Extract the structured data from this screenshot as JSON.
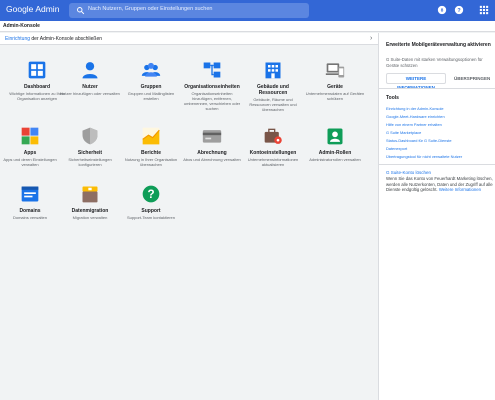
{
  "header": {
    "brand_google": "Google",
    "brand_product": "Admin",
    "search_placeholder": "Nach Nutzern, Gruppen oder Einstellungen suchen",
    "colors": {
      "bar": "#3367d6",
      "search": "#5b86e0"
    },
    "icons": [
      "search-icon",
      "support-icon",
      "help-icon",
      "apps-grid-icon"
    ]
  },
  "breadcrumb": {
    "label": "Admin-Konsole"
  },
  "setup_banner": {
    "link": "Einrichtung",
    "text": " der Admin-Konsole abschließen"
  },
  "tiles": [
    {
      "id": "dashboard",
      "title": "Dashboard",
      "desc": "Wichtige Informationen zu Ihrer Organisation anzeigen"
    },
    {
      "id": "users",
      "title": "Nutzer",
      "desc": "Nutzer hinzufügen oder verwalten"
    },
    {
      "id": "groups",
      "title": "Gruppen",
      "desc": "Gruppen und Mailinglisten erstellen"
    },
    {
      "id": "orgunits",
      "title": "Organisationseinheiten",
      "desc": "Organisationseinheiten hinzufügen, entfernen, umbenennen, verschieben oder suchen"
    },
    {
      "id": "buildings",
      "title": "Gebäude und Ressourcen",
      "desc": "Gebäude, Räume und Ressourcen verwalten und überwachen"
    },
    {
      "id": "devices",
      "title": "Geräte",
      "desc": "Unternehmensdaten auf Geräten schützen"
    },
    {
      "id": "apps",
      "title": "Apps",
      "desc": "Apps und deren Einstellungen verwalten"
    },
    {
      "id": "security",
      "title": "Sicherheit",
      "desc": "Sicherheitseinstellungen konfigurieren"
    },
    {
      "id": "reports",
      "title": "Berichte",
      "desc": "Nutzung in Ihrer Organisation überwachen"
    },
    {
      "id": "billing",
      "title": "Abrechnung",
      "desc": "Abos und Abrechnung verwalten"
    },
    {
      "id": "account",
      "title": "Kontoeinstellungen",
      "desc": "Unternehmensinformationen aktualisieren"
    },
    {
      "id": "roles",
      "title": "Admin-Rollen",
      "desc": "Administratorrollen verwalten"
    },
    {
      "id": "domains",
      "title": "Domains",
      "desc": "Domains verwalten"
    },
    {
      "id": "migration",
      "title": "Datenmigration",
      "desc": "Migration verwalten"
    },
    {
      "id": "support",
      "title": "Support",
      "desc": "Support-Team kontaktieren"
    }
  ],
  "panel": {
    "title": "Erweiterte Mobilgeräteverwaltung aktivieren",
    "desc": "G Suite-Daten mit starken Verwaltungsoptionen für Geräte schützen",
    "btn_more": "WEITERE INFORMATIONEN",
    "btn_skip": "ÜBERSPRINGEN",
    "tools_title": "Tools",
    "tools": [
      "Einrichtung in der Admin-Konsole",
      "Google-Meet-Hardware einrichten",
      "Hilfe von einem Partner erhalten",
      "G Suite Marketplace",
      "Status-Dashboard für G Suite-Dienste",
      "Datenexport",
      "Übertragungstool für nicht verwaltete Nutzer"
    ],
    "gsuite_title": "G Suite-Konto löschen",
    "gsuite_text": "Wenn Sie das Konto von Feuerhardt Marketing löschen, werden alle Nutzerkonten, Daten und der Zugriff auf alle Dienste endgültig gelöscht.",
    "gsuite_link": "Weitere Informationen"
  }
}
